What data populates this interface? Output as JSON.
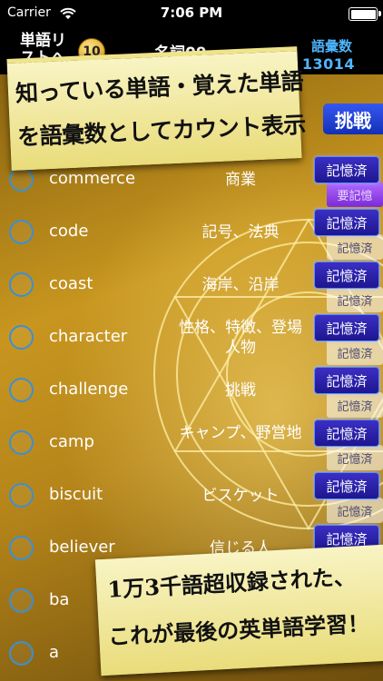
{
  "status_bar": {
    "carrier": "Carrier",
    "time": "7:06 PM"
  },
  "header": {
    "back_label": "単語リストへ",
    "level_badge": "10",
    "category_title": "名詞09",
    "vocab_label": "語彙数",
    "vocab_count": "13014",
    "progress": 0.72
  },
  "challenge_button": "挑戦",
  "promo_top": {
    "line1": "知っている単語・覚えた単語",
    "line2": "を語彙数としてカウント表示"
  },
  "promo_bottom": {
    "line1": "1万3千語超収録された、",
    "line2": "これが最後の英単語学習！"
  },
  "memorized_label": "記憶済",
  "ghost_labels": {
    "need": "要記憶",
    "memorized": "記憶済"
  },
  "words": [
    {
      "word": "commerce",
      "meaning": "商業"
    },
    {
      "word": "code",
      "meaning": "記号、法典"
    },
    {
      "word": "coast",
      "meaning": "海岸、沿岸"
    },
    {
      "word": "character",
      "meaning": "性格、特徴、登場人物"
    },
    {
      "word": "challenge",
      "meaning": "挑戦"
    },
    {
      "word": "camp",
      "meaning": "キャンプ、野営地"
    },
    {
      "word": "biscuit",
      "meaning": "ビスケット"
    },
    {
      "word": "believer",
      "meaning": "信じる人"
    },
    {
      "word": "ba",
      "meaning": ""
    },
    {
      "word": "a",
      "meaning": ""
    }
  ],
  "colors": {
    "accent_blue": "#4fb6ff",
    "memo_button": "#2a1fb0",
    "banner": "#f3eca4"
  }
}
